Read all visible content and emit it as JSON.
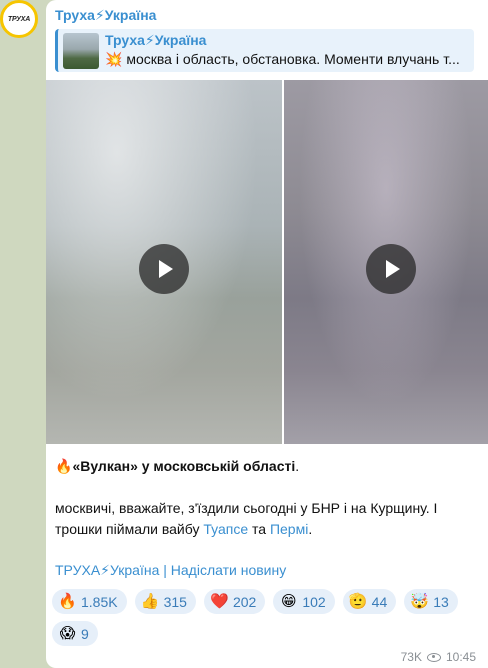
{
  "avatar": {
    "label": "ТРУХА"
  },
  "channel": {
    "name": "Труха⚡Україна"
  },
  "forward": {
    "title": "Труха⚡Україна",
    "text": "💥 москва і область, обстановка. Моменти влучань т..."
  },
  "media": [
    {
      "type": "video",
      "icon": "play-icon"
    },
    {
      "type": "video",
      "icon": "play-icon"
    }
  ],
  "message": {
    "line1_emoji": "🔥",
    "line1_bold": "«Вулкан» у московській області",
    "line1_end": ".",
    "line2_start": "москвичі, вважайте, з'їздили сьогодні у БНР і на Курщину. І трошки піймали вайбу ",
    "link1": "Туапсе",
    "between_links": " та ",
    "link2": "Пермі",
    "line2_end": "."
  },
  "footer_link": "ТРУХА⚡Україна | Надіслати новину",
  "reactions": [
    {
      "emoji": "🔥",
      "count": "1.85K",
      "icon": "fire-icon"
    },
    {
      "emoji": "👍",
      "count": "315",
      "icon": "thumbs-up-icon"
    },
    {
      "emoji": "❤️",
      "count": "202",
      "icon": "heart-icon"
    },
    {
      "emoji": "😁",
      "count": "102",
      "icon": "grin-icon"
    },
    {
      "emoji": "🫡",
      "count": "44",
      "icon": "salute-icon"
    },
    {
      "emoji": "🤯",
      "count": "13",
      "icon": "mind-blown-icon"
    },
    {
      "emoji": "😱",
      "count": "9",
      "icon": "scream-icon"
    }
  ],
  "meta": {
    "views": "73K",
    "time": "10:45"
  },
  "colors": {
    "accent": "#3a8fd0",
    "background": "#cfd8bf",
    "reaction_bg": "#e6eff9"
  }
}
